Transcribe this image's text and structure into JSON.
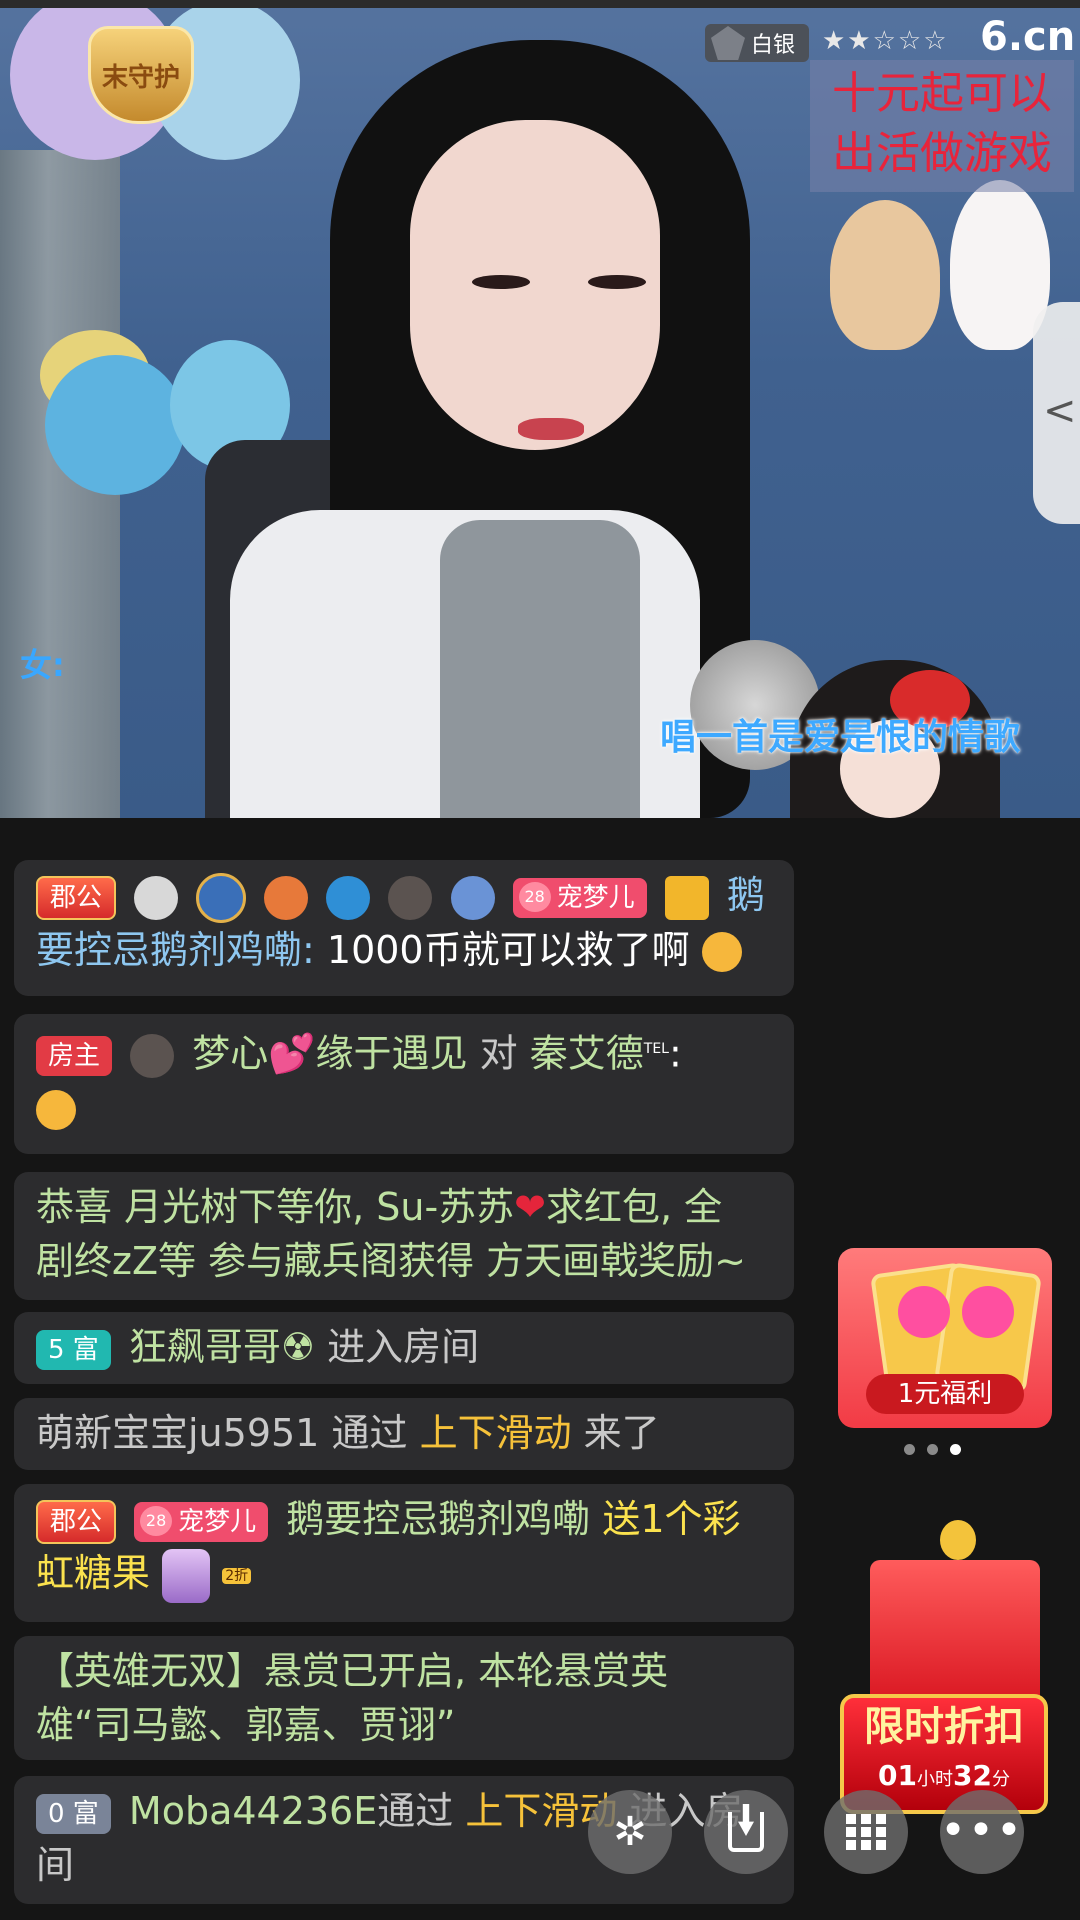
{
  "stream": {
    "logo_text": "末守护",
    "rank": "白银",
    "stars": "★★☆☆☆",
    "site": "6.cn",
    "promo_line1": "十元起可以",
    "promo_line2": "出活做游戏",
    "caption_left": "女:",
    "caption": "唱一首是爱是恨的情歌",
    "side_tab_icon": "<"
  },
  "chat": {
    "messages": [
      {
        "badges": [
          "郡公",
          "宠梦儿"
        ],
        "user": "鹅要控忌鹅剂鸡嘞",
        "user_part1": "鹅",
        "user_part2": "要控忌鹅剂鸡嘞:",
        "text": "1000币就可以救了啊"
      },
      {
        "badge": "房主",
        "user": "梦心",
        "user_suffix": "缘于遇见",
        "mid": "对",
        "target": "秦艾德",
        "target_sup": "TEL",
        "colon": ":"
      },
      {
        "line1": "恭喜 月光树下等你, Su-苏苏",
        "line1b": "求红包, 全",
        "line2": "剧终zZ等 参与藏兵阁获得 方天画戟奖励~"
      },
      {
        "badge": "5 富",
        "user": "狂飙哥哥☢",
        "action": "进入房间"
      },
      {
        "user": "萌新宝宝ju5951",
        "via": "通过",
        "method": "上下滑动",
        "action": "来了"
      },
      {
        "badges": [
          "郡公",
          "宠梦儿"
        ],
        "user": "鹅要控忌鹅剂鸡嘞",
        "gift_line1": "送1个彩",
        "gift_line2": "虹糖果",
        "gift_tag": "2折"
      },
      {
        "line1": "【英雄无双】悬赏已开启, 本轮悬赏英",
        "line2": "雄“司马懿、郭嘉、贾诩”"
      },
      {
        "badge": "0 富",
        "user": "Moba44236E",
        "via": "通过",
        "method": "上下滑动",
        "action": "进入房",
        "action2": "间"
      }
    ]
  },
  "promos": {
    "welfare_label": "1元福利",
    "discount_title": "限时折扣",
    "countdown_h": "01",
    "countdown_h_unit": "小时",
    "countdown_m": "32",
    "countdown_m_unit": "分"
  },
  "toolbar": {
    "more_label": "•••"
  },
  "colors": {
    "chat_bg": "#2c2c2e",
    "username": "#bfe2a2",
    "highlight": "#f6c23a"
  }
}
